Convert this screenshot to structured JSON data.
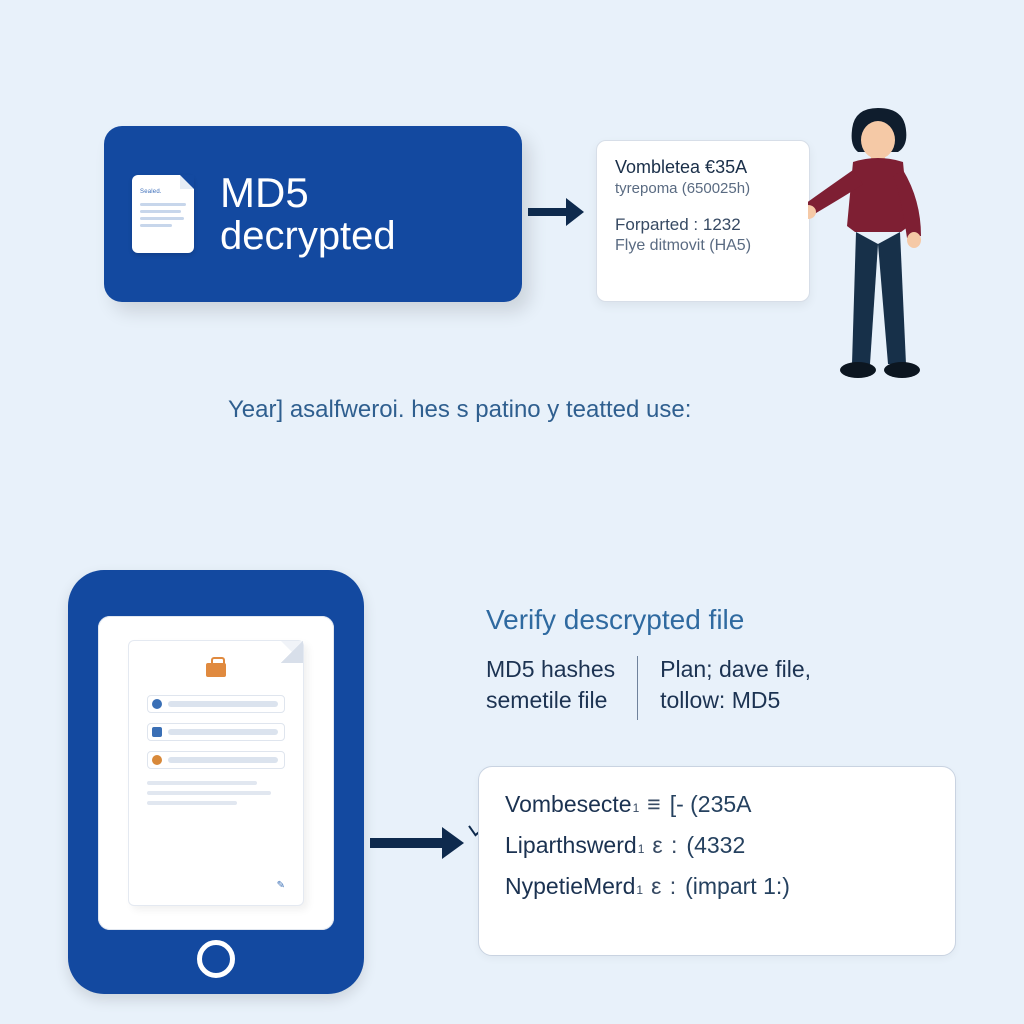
{
  "top_card": {
    "doc_label": "Sealed.",
    "line1": "MD5",
    "line2": "decrypted"
  },
  "top_info": {
    "row1a": "Vombletea  €35A",
    "row1b": "tyrepoma (650025h)",
    "row2a": "Forparted : 1232",
    "row2b": "Flye ditmovit (HA5)"
  },
  "caption": "Year] asalfweroi. hes s patino y teatted use:",
  "verify_heading": "Verify descrypted file",
  "columns": {
    "left": {
      "l1": "MD5 hashes",
      "l2": "semetile file"
    },
    "right": {
      "l1": "Plan; dave file,",
      "l2": "tollow: MD5"
    }
  },
  "hashes": [
    {
      "key": "Vombesecte",
      "sup": "1",
      "op": "≡",
      "val": "[- (235A"
    },
    {
      "key": "Liparthswerd",
      "sup": "1",
      "op": "ε :",
      "val": "(4332"
    },
    {
      "key": "NypetieMerd",
      "sup": "1",
      "op": "ε :",
      "val": "(impart 1:)"
    }
  ],
  "device_doc_signature": "✎"
}
